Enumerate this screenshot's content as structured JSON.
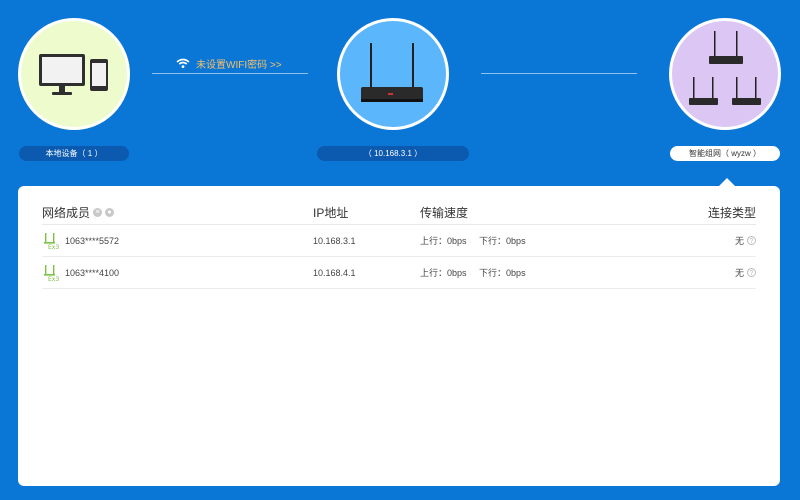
{
  "topology": {
    "local": {
      "label": "本地设备（ 1 ）",
      "circle_color": "#eefbcc"
    },
    "router": {
      "label": "（ 10.168.3.1 ）",
      "circle_color": "#5bb6fb"
    },
    "mesh": {
      "label": "智能组网（ wyzw ）",
      "circle_color": "#dcc7f4"
    },
    "wifi_link": "未设置WIFI密码 >>"
  },
  "table": {
    "headers": {
      "member": "网络成员",
      "ip": "IP地址",
      "speed": "传输速度",
      "conn_type": "连接类型"
    },
    "rows": [
      {
        "device": "1063****5572",
        "ip": "10.168.3.1",
        "up": "上行：0bps",
        "down": "下行：0bps",
        "conn": "无"
      },
      {
        "device": "1063****4100",
        "ip": "10.168.4.1",
        "up": "上行：0bps",
        "down": "下行：0bps",
        "conn": "无"
      }
    ]
  },
  "colors": {
    "background": "#0a76d6",
    "accent_green": "#7bc043",
    "wifi_text": "#f7c06a"
  }
}
